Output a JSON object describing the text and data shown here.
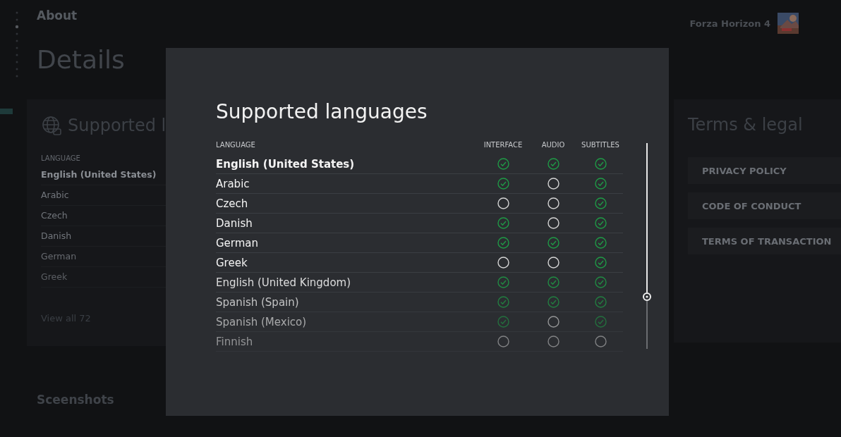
{
  "background": {
    "breadcrumb": "About",
    "title": "Details",
    "game": {
      "name": "Forza Horizon 4"
    },
    "languages_card": {
      "title": "Supported l",
      "column": "LANGUAGE",
      "items": [
        {
          "label": "English (United States)",
          "bold": true
        },
        {
          "label": "Arabic",
          "bold": false
        },
        {
          "label": "Czech",
          "bold": false
        },
        {
          "label": "Danish",
          "bold": false
        },
        {
          "label": "German",
          "bold": false
        },
        {
          "label": "Greek",
          "bold": false
        }
      ],
      "link": "View all 72"
    },
    "legal_card": {
      "title": "Terms & legal",
      "buttons": [
        "PRIVACY POLICY",
        "CODE OF CONDUCT",
        "TERMS OF TRANSACTION"
      ]
    },
    "section": "Sceenshots"
  },
  "dialog": {
    "title": "Supported languages",
    "columns": [
      "LANGUAGE",
      "INTERFACE",
      "AUDIO",
      "SUBTITLES"
    ],
    "rows": [
      {
        "language": "English (United States)",
        "bold": true,
        "interface": true,
        "audio": true,
        "subtitles": true
      },
      {
        "language": "Arabic",
        "bold": false,
        "interface": true,
        "audio": false,
        "subtitles": true
      },
      {
        "language": "Czech",
        "bold": false,
        "interface": false,
        "audio": false,
        "subtitles": true
      },
      {
        "language": "Danish",
        "bold": false,
        "interface": true,
        "audio": false,
        "subtitles": true
      },
      {
        "language": "German",
        "bold": false,
        "interface": true,
        "audio": true,
        "subtitles": true
      },
      {
        "language": "Greek",
        "bold": false,
        "interface": false,
        "audio": false,
        "subtitles": true
      },
      {
        "language": "English (United Kingdom)",
        "bold": false,
        "interface": true,
        "audio": true,
        "subtitles": true
      },
      {
        "language": "Spanish (Spain)",
        "bold": false,
        "interface": true,
        "audio": true,
        "subtitles": true
      },
      {
        "language": "Spanish (Mexico)",
        "bold": false,
        "interface": true,
        "audio": false,
        "subtitles": true
      },
      {
        "language": "Finnish",
        "bold": false,
        "interface": false,
        "audio": false,
        "subtitles": false
      }
    ]
  }
}
